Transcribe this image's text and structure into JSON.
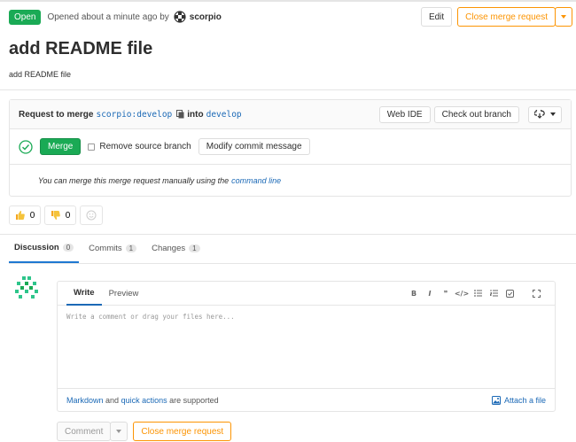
{
  "header": {
    "status": "Open",
    "opened_text": "Opened about a minute ago by",
    "author": "scorpio",
    "edit_label": "Edit",
    "close_label": "Close merge request"
  },
  "title": "add README file",
  "description": "add README file",
  "widget": {
    "request_label": "Request to merge",
    "source_branch": "scorpio:develop",
    "into_label": "into",
    "target_branch": "develop",
    "web_ide_label": "Web IDE",
    "checkout_label": "Check out branch",
    "merge_label": "Merge",
    "remove_source_label": "Remove source branch",
    "modify_commit_label": "Modify commit message",
    "manual_text": "You can merge this merge request manually using the",
    "command_line_label": "command line"
  },
  "awards": {
    "thumbsup_count": "0",
    "thumbsdown_count": "0"
  },
  "tabs": [
    {
      "label": "Discussion",
      "count": "0"
    },
    {
      "label": "Commits",
      "count": "1"
    },
    {
      "label": "Changes",
      "count": "1"
    }
  ],
  "editor": {
    "write_label": "Write",
    "preview_label": "Preview",
    "placeholder": "Write a comment or drag your files here...",
    "markdown_label": "Markdown",
    "and_label": "and",
    "quick_actions_label": "quick actions",
    "supported_label": "are supported",
    "attach_label": "Attach a file",
    "toolbar": [
      "B",
      "I",
      "❞",
      "</>"
    ]
  },
  "actions": {
    "comment_label": "Comment",
    "close_label": "Close merge request"
  },
  "colors": {
    "success": "#1aaa55",
    "warning": "#fc9403",
    "link": "#1b69b6"
  }
}
